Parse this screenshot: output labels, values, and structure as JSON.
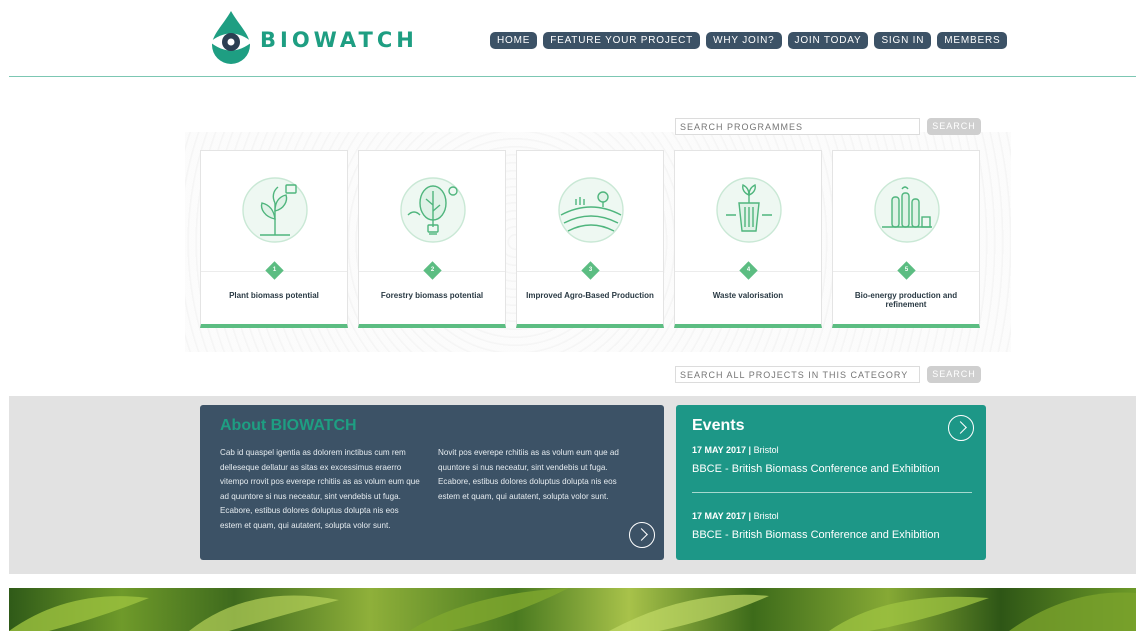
{
  "brand": {
    "name": "BIOWATCH"
  },
  "nav": [
    {
      "label": "HOME"
    },
    {
      "label": "FEATURE YOUR PROJECT"
    },
    {
      "label": "WHY JOIN?"
    },
    {
      "label": "JOIN TODAY"
    },
    {
      "label": "SIGN IN"
    },
    {
      "label": "MEMBERS"
    }
  ],
  "programme_search": {
    "placeholder": "SEARCH PROGRAMMES",
    "button": "SEARCH"
  },
  "programmes": [
    {
      "number": "1",
      "title": "Plant biomass potential",
      "icon": "plant-icon"
    },
    {
      "number": "2",
      "title": "Forestry biomass potential",
      "icon": "tree-bulb-icon"
    },
    {
      "number": "3",
      "title": "Improved Agro-Based Production",
      "icon": "fields-icon"
    },
    {
      "number": "4",
      "title": "Waste valorisation",
      "icon": "waste-bin-icon"
    },
    {
      "number": "5",
      "title": "Bio-energy production and refinement",
      "icon": "factory-icon"
    }
  ],
  "project_search": {
    "placeholder": "SEARCH ALL PROJECTS IN THIS CATEGORY",
    "button": "SEARCH"
  },
  "about": {
    "title": "About BIOWATCH",
    "col1": "Cab id quaspel igentia as dolorem inctibus cum rem delleseque dellatur as sitas ex excessimus eraerro vitempo rrovit pos everepe rchitiis as as volum eum que ad quuntore si nus neceatur, sint vendebis ut fuga. Ecabore, estibus dolores doluptus dolupta nis eos estem et quam, qui autatent, solupta volor sunt.",
    "col2": "Novit pos everepe rchitiis as as volum eum que ad quuntore si nus neceatur, sint vendebis ut fuga. Ecabore, estibus dolores doluptus dolupta nis eos estem et quam, qui autatent, solupta volor sunt."
  },
  "events": {
    "title": "Events",
    "items": [
      {
        "date": "17 MAY 2017",
        "location": "Bristol",
        "name": "BBCE - British Biomass Conference and Exhibition"
      },
      {
        "date": "17 MAY 2017",
        "location": "Bristol",
        "name": "BBCE - British Biomass Conference and Exhibition"
      }
    ]
  },
  "colors": {
    "accent": "#1e9e82",
    "nav": "#3c5266",
    "card_bar": "#5cbd82",
    "events_bg": "#1d9787"
  }
}
